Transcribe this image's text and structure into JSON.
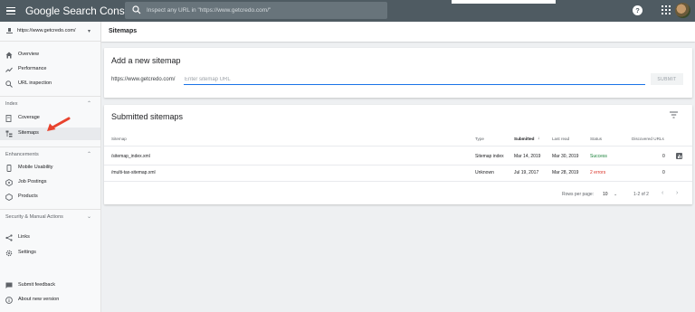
{
  "app": {
    "title": "Google Search Console"
  },
  "search": {
    "placeholder": "Inspect any URL in \"https://www.getcredo.com/\""
  },
  "property": {
    "url": "https://www.getcredo.com/"
  },
  "sidebar": {
    "items_top": [
      {
        "label": "Overview",
        "icon": "home-icon"
      },
      {
        "label": "Performance",
        "icon": "trending-up-icon"
      },
      {
        "label": "URL inspection",
        "icon": "search-icon"
      }
    ],
    "sections": [
      {
        "label": "Index",
        "items": [
          {
            "label": "Coverage",
            "icon": "coverage-icon"
          },
          {
            "label": "Sitemaps",
            "icon": "sitemap-icon",
            "active": true
          }
        ]
      },
      {
        "label": "Enhancements",
        "items": [
          {
            "label": "Mobile Usability",
            "icon": "phone-icon"
          },
          {
            "label": "Job Postings",
            "icon": "job-icon"
          },
          {
            "label": "Products",
            "icon": "product-icon"
          }
        ]
      },
      {
        "label": "Security & Manual Actions",
        "items": []
      }
    ],
    "items_bottom": [
      {
        "label": "Links",
        "icon": "links-icon"
      },
      {
        "label": "Settings",
        "icon": "gear-icon"
      }
    ],
    "footer": [
      {
        "label": "Submit feedback",
        "icon": "feedback-icon"
      },
      {
        "label": "About new version",
        "icon": "info-icon"
      }
    ]
  },
  "page": {
    "title": "Sitemaps"
  },
  "add_card": {
    "title": "Add a new sitemap",
    "prefix": "https://www.getcredo.com/",
    "placeholder": "Enter sitemap URL",
    "submit_label": "SUBMIT"
  },
  "list_card": {
    "title": "Submitted sitemaps",
    "columns": [
      "Sitemap",
      "Type",
      "Submitted",
      "Last read",
      "Status",
      "Discovered URLs"
    ],
    "sort_indicator": "↓",
    "rows": [
      {
        "sitemap": "/sitemap_index.xml",
        "type": "Sitemap index",
        "submitted": "Mar 14, 2019",
        "last_read": "Mar 30, 2019",
        "status": "Success",
        "status_kind": "success",
        "discovered": "0"
      },
      {
        "sitemap": "/multi-tax-sitemap.xml",
        "type": "Unknown",
        "submitted": "Jul 19, 2017",
        "last_read": "Mar 28, 2019",
        "status": "2 errors",
        "status_kind": "error",
        "discovered": "0"
      }
    ],
    "pagination": {
      "rows_per_page_label": "Rows per page:",
      "rows_per_page": "10",
      "range": "1-2 of 2"
    }
  },
  "colors": {
    "topbar": "#4f5b62",
    "accent": "#1a73e8",
    "success": "#188038",
    "error": "#d93025",
    "annotation_arrow": "#e8432e"
  }
}
